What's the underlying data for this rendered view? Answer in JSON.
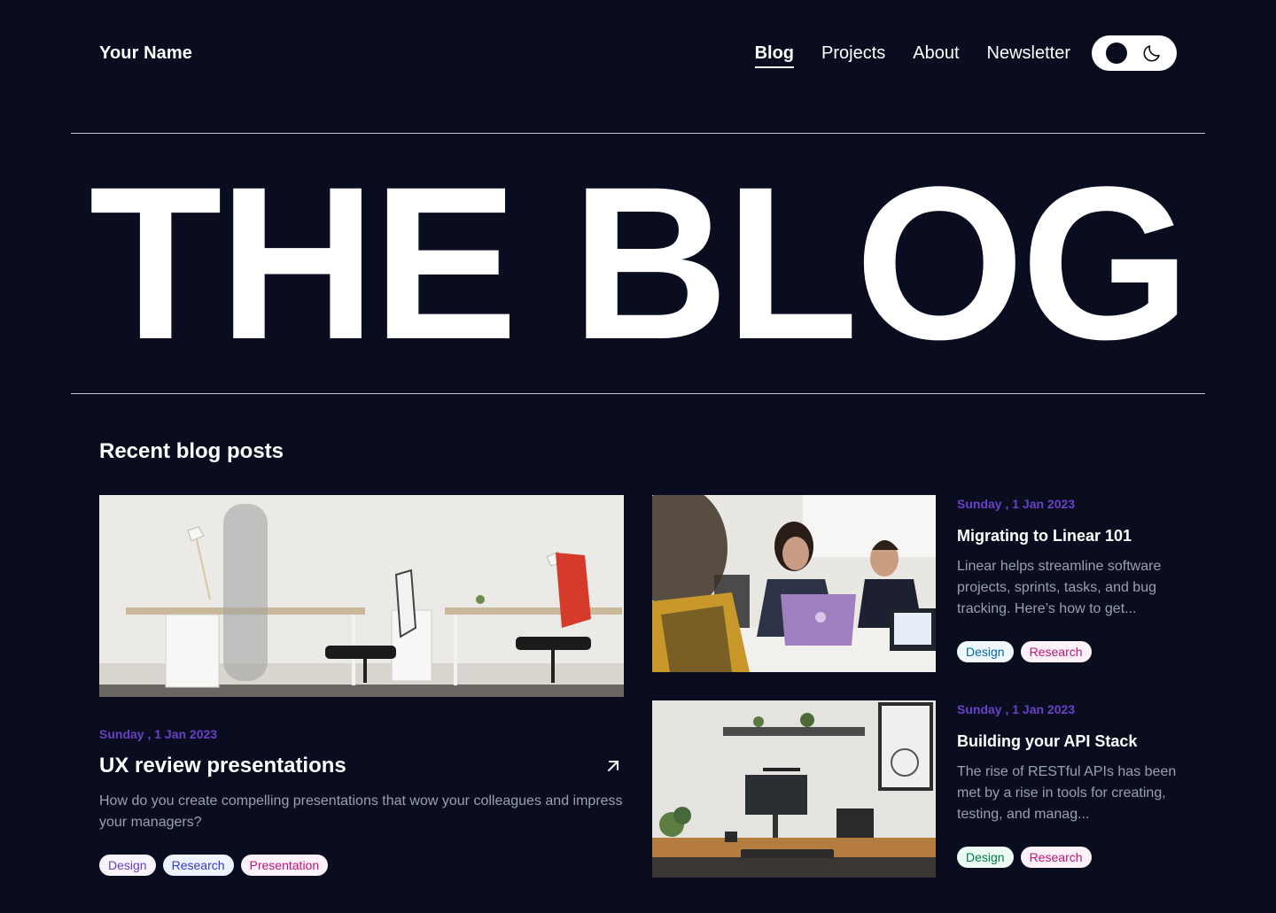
{
  "header": {
    "site_name": "Your Name",
    "nav": [
      {
        "label": "Blog",
        "active": true
      },
      {
        "label": "Projects",
        "active": false
      },
      {
        "label": "About",
        "active": false
      },
      {
        "label": "Newsletter",
        "active": false
      }
    ],
    "theme_toggle": {
      "icons": [
        "circle-icon",
        "moon-icon"
      ]
    }
  },
  "hero": {
    "title": "THE BLOG"
  },
  "recent": {
    "section_title": "Recent blog posts",
    "featured": {
      "date": "Sunday , 1 Jan 2023",
      "title": "UX review presentations",
      "excerpt": "How do you create compelling presentations that wow your colleagues and impress your managers?",
      "tags": [
        {
          "label": "Design",
          "bg": "#f9f5ff",
          "fg": "#6941c6"
        },
        {
          "label": "Research",
          "bg": "#eef4ff",
          "fg": "#3538cd"
        },
        {
          "label": "Presentation",
          "bg": "#fdf2fa",
          "fg": "#c11574"
        }
      ]
    },
    "posts": [
      {
        "date": "Sunday , 1 Jan 2023",
        "title": "Migrating to Linear 101",
        "excerpt": "Linear helps streamline software projects, sprints, tasks, and bug tracking. Here’s how to get...",
        "tags": [
          {
            "label": "Design",
            "bg": "#f0f9ff",
            "fg": "#026aa2"
          },
          {
            "label": "Research",
            "bg": "#fdf2fa",
            "fg": "#c11574"
          }
        ]
      },
      {
        "date": "Sunday , 1 Jan 2023",
        "title": "Building your API Stack",
        "excerpt": "The rise of RESTful APIs has been met by a rise in tools for creating, testing, and manag...",
        "tags": [
          {
            "label": "Design",
            "bg": "#ecfdf3",
            "fg": "#027a48"
          },
          {
            "label": "Research",
            "bg": "#fdf2fa",
            "fg": "#c11574"
          }
        ]
      }
    ]
  },
  "colors": {
    "background": "#090d1f",
    "accent_date": "#6941c6",
    "text": "#ffffff",
    "muted": "#c0c5d0"
  }
}
